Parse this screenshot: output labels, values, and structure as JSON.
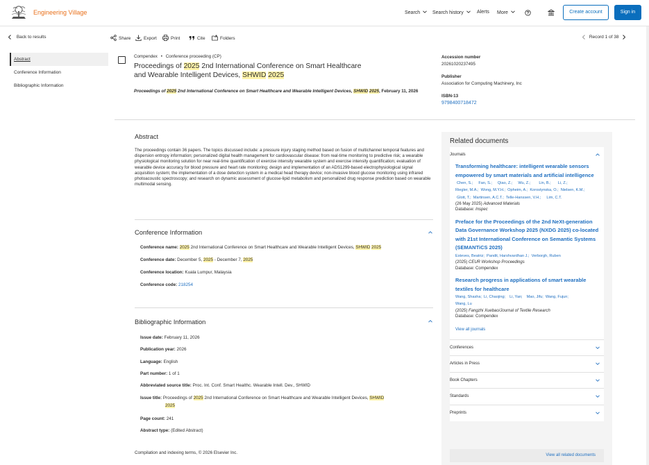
{
  "header": {
    "brand": "Engineering Village",
    "nav": {
      "search": "Search",
      "search_history": "Search history",
      "alerts": "Alerts",
      "more": "More"
    },
    "create_account": "Create account",
    "sign_in": "Sign in",
    "brand_color": "#e9711c",
    "accent_color": "#0a6ebd"
  },
  "toolbar": {
    "back": "Back to results",
    "share": "Share",
    "export": "Export",
    "print": "Print",
    "cite": "Cite",
    "folders": "Folders",
    "record": "Record 1 of 38"
  },
  "leftnav": {
    "items": [
      "Abstract",
      "Conference Information",
      "Bibliographic Information"
    ]
  },
  "record": {
    "database": "Compendex",
    "bullet": "•",
    "doc_type": "Conference proceeding (CP)",
    "title_parts": [
      "Proceedings of ",
      "2025",
      " 2nd International Conference on Smart Healthcare and Wearable Intelligent Devices, ",
      "SHWID",
      " ",
      "2025"
    ],
    "source_parts": [
      "Proceedings of ",
      "2025",
      " 2nd International Conference on Smart Healthcare and Wearable Intelligent Devices, ",
      "SHWID",
      " ",
      "2025",
      ", February 11, 2026"
    ]
  },
  "meta": {
    "accession_label": "Accession number",
    "accession_value": "20261020237495",
    "publisher_label": "Publisher",
    "publisher_value": "Association for Computing Machinery, Inc",
    "isbn_label": "ISBN-13",
    "isbn_value": "9798400718472"
  },
  "abstract": {
    "heading": "Abstract",
    "text": "The proceedings contain 36 papers. The topics discussed include: a pressure injury staging method based on fusion of multichannel temporal features and dispersion entropy information; personalized digital health management for cardiovascular disease: from real-time monitoring to predictive risk; a wearable physiological monitoring solution for near real-time quantification of exercise intensity wearable system and exercise intensity quantification; evaluation of wearable device accuracy for blood pressure and heart rate monitoring; design and implementation of an ADS1299-based electrophysiological signal acquisition system; the implementation of a dose detection system in a medical head therapy device; non-invasive blood glucose monitoring using infrared photoacoustic spectroscopy; and research on dynamic assessment of glucose-lipid metabolism and personalized drug response prediction based on wearable multimodal sensing."
  },
  "conference": {
    "heading": "Conference Information",
    "name_label": "Conference name:",
    "name_parts": [
      " ",
      "2025",
      " 2nd International Conference on Smart Healthcare and Wearable Intelligent Devices, ",
      "SHWID",
      " ",
      "2025"
    ],
    "date_label": "Conference date:",
    "date_parts": [
      " December 5, ",
      "2025",
      " - December 7, ",
      "2025"
    ],
    "location_label": "Conference location:",
    "location_value": " Kuala Lumpur, Malaysia",
    "code_label": "Conference code:",
    "code_value": "218254"
  },
  "biblio": {
    "heading": "Bibliographic Information",
    "issue_date_label": "Issue date:",
    "issue_date_value": " February 11, 2026",
    "pub_year_label": "Publication year:",
    "pub_year_value": " 2026",
    "language_label": "Language:",
    "language_value": " English",
    "part_label": "Part number:",
    "part_value": " 1 of 1",
    "abbrev_label": "Abbreviated source title:",
    "abbrev_value": " Proc. Int. Conf. Smart Healthc. Wearable Intell. Dev., SHWID",
    "issue_title_label": "Issue title:",
    "issue_title_parts": [
      " Proceedings of ",
      "2025",
      " 2nd International Conference on Smart Healthcare and Wearable Intelligent Devices, ",
      "SHWID",
      "2025"
    ],
    "page_count_label": "Page count:",
    "page_count_value": " 241",
    "abstract_type_label": "Abstract type:",
    "abstract_type_value": " (Edited Abstract)"
  },
  "footer": {
    "text": "Compilation and indexing terms, © 2026 Elsevier Inc."
  },
  "related": {
    "heading": "Related documents",
    "journals_label": "Journals",
    "docs": [
      {
        "title": "Transforming healthcare: intelligent wearable sensors empowered by smart materials and artificial intelligence",
        "authors": [
          "Chen, S.;",
          "Fan, S.;",
          "Qiao, Z.;",
          "Wu, Z.;",
          "Lin, B.;",
          "Li, Z.;",
          "Riegler, M.A.;",
          "Wong, M.Y.H.;",
          "Opheim, A.;",
          "Korostynska, O.;",
          "Nielsen, K.M.;",
          "Glott, T.;",
          "Martinsen, A.C.T.;",
          "Telle-Hanssen, V.H.;",
          "Lim, C.T."
        ],
        "date": "(26 May 2025)",
        "journal": "Advanced Materials",
        "db_label": "Database:",
        "db": "Inspec"
      },
      {
        "title": "Preface for the Proceedings of the 2nd NeXt-generation Data Governance Workshop 2025 (NXDG 2025) co-located with 21st International Conference on Semantic Systems (SEMANTiCS 2025)",
        "authors": [
          "Esteves, Beatriz;",
          "Pandit, Harshvardhan J.;",
          "Verborgh, Ruben"
        ],
        "date": "(2025)",
        "journal": "CEUR Workshop Proceedings",
        "db_label": "Database:",
        "db": "Compendex"
      },
      {
        "title": "Research progress in applications of smart wearable textiles for healthcare",
        "authors": [
          "Wang, Shasha;",
          "Li, Chaojing;",
          "Li, Yan;",
          "Mao, Jifu;",
          "Wang, Fujun;",
          "Wang, Lu"
        ],
        "date": "(2025)",
        "journal": "Fangzhi Xuebao/Journal of Textile Research",
        "db_label": "Database:",
        "db": "Compendex"
      }
    ],
    "view_journals": "View all journals",
    "sections": [
      "Conferences",
      "Articles in Press",
      "Book Chapters",
      "Standards",
      "Preprints"
    ],
    "view_all": "View all related documents"
  }
}
